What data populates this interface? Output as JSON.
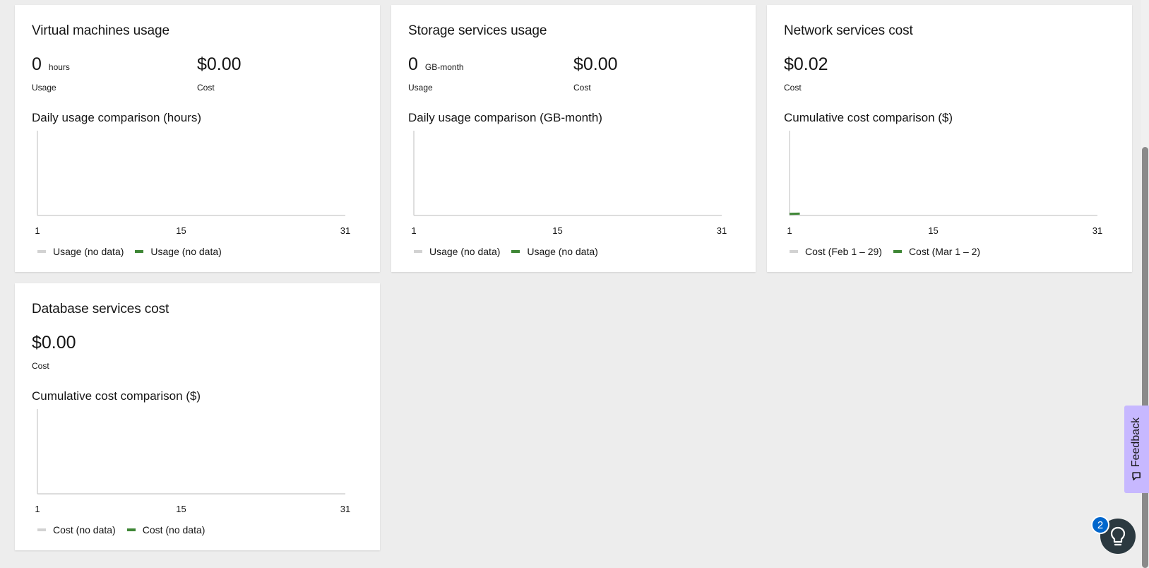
{
  "cards": [
    {
      "title": "Virtual machines usage",
      "usage_value": "0",
      "usage_unit": "hours",
      "usage_label": "Usage",
      "cost_value": "$0.00",
      "cost_label": "Cost",
      "chart_title": "Daily usage comparison (hours)",
      "ticks": [
        "1",
        "15",
        "31"
      ],
      "legend": [
        "Usage (no data)",
        "Usage (no data)"
      ]
    },
    {
      "title": "Storage services usage",
      "usage_value": "0",
      "usage_unit": "GB-month",
      "usage_label": "Usage",
      "cost_value": "$0.00",
      "cost_label": "Cost",
      "chart_title": "Daily usage comparison (GB-month)",
      "ticks": [
        "1",
        "15",
        "31"
      ],
      "legend": [
        "Usage (no data)",
        "Usage (no data)"
      ]
    },
    {
      "title": "Network services cost",
      "cost_value": "$0.02",
      "cost_label": "Cost",
      "chart_title": "Cumulative cost comparison ($)",
      "ticks": [
        "1",
        "15",
        "31"
      ],
      "legend": [
        "Cost (Feb 1 – 29)",
        "Cost (Mar 1 – 2)"
      ]
    },
    {
      "title": "Database services cost",
      "cost_value": "$0.00",
      "cost_label": "Cost",
      "chart_title": "Cumulative cost comparison ($)",
      "ticks": [
        "1",
        "15",
        "31"
      ],
      "legend": [
        "Cost (no data)",
        "Cost (no data)"
      ]
    }
  ],
  "chart_data": [
    {
      "type": "line",
      "x": [
        1,
        15,
        31
      ],
      "xlim": [
        1,
        31
      ],
      "series": [
        {
          "name": "Usage (no data)",
          "color": "#d2d2d2",
          "x": [],
          "values": []
        },
        {
          "name": "Usage (no data)",
          "color": "#3e8635",
          "x": [],
          "values": []
        }
      ],
      "ylabel": "",
      "title": "Daily usage comparison (hours)"
    },
    {
      "type": "line",
      "x": [
        1,
        15,
        31
      ],
      "xlim": [
        1,
        31
      ],
      "series": [
        {
          "name": "Usage (no data)",
          "color": "#d2d2d2",
          "x": [],
          "values": []
        },
        {
          "name": "Usage (no data)",
          "color": "#3e8635",
          "x": [],
          "values": []
        }
      ],
      "title": "Daily usage comparison (GB-month)"
    },
    {
      "type": "line",
      "x": [
        1,
        15,
        31
      ],
      "xlim": [
        1,
        31
      ],
      "series": [
        {
          "name": "Cost (Feb 1 – 29)",
          "color": "#d2d2d2",
          "x": [],
          "values": []
        },
        {
          "name": "Cost (Mar 1 – 2)",
          "color": "#3e8635",
          "x": [
            1,
            2
          ],
          "values": [
            0.01,
            0.02
          ]
        }
      ],
      "title": "Cumulative cost comparison ($)"
    },
    {
      "type": "line",
      "x": [
        1,
        15,
        31
      ],
      "xlim": [
        1,
        31
      ],
      "series": [
        {
          "name": "Cost (no data)",
          "color": "#d2d2d2",
          "x": [],
          "values": []
        },
        {
          "name": "Cost (no data)",
          "color": "#3e8635",
          "x": [],
          "values": []
        }
      ],
      "title": "Cumulative cost comparison ($)"
    }
  ],
  "feedback": {
    "label": "Feedback"
  },
  "help": {
    "badge_count": "2"
  },
  "colors": {
    "accent_green": "#3e8635",
    "legend_gray": "#d2d2d2",
    "feedback_bg": "#c7b8ff",
    "badge_blue": "#0066cc"
  }
}
